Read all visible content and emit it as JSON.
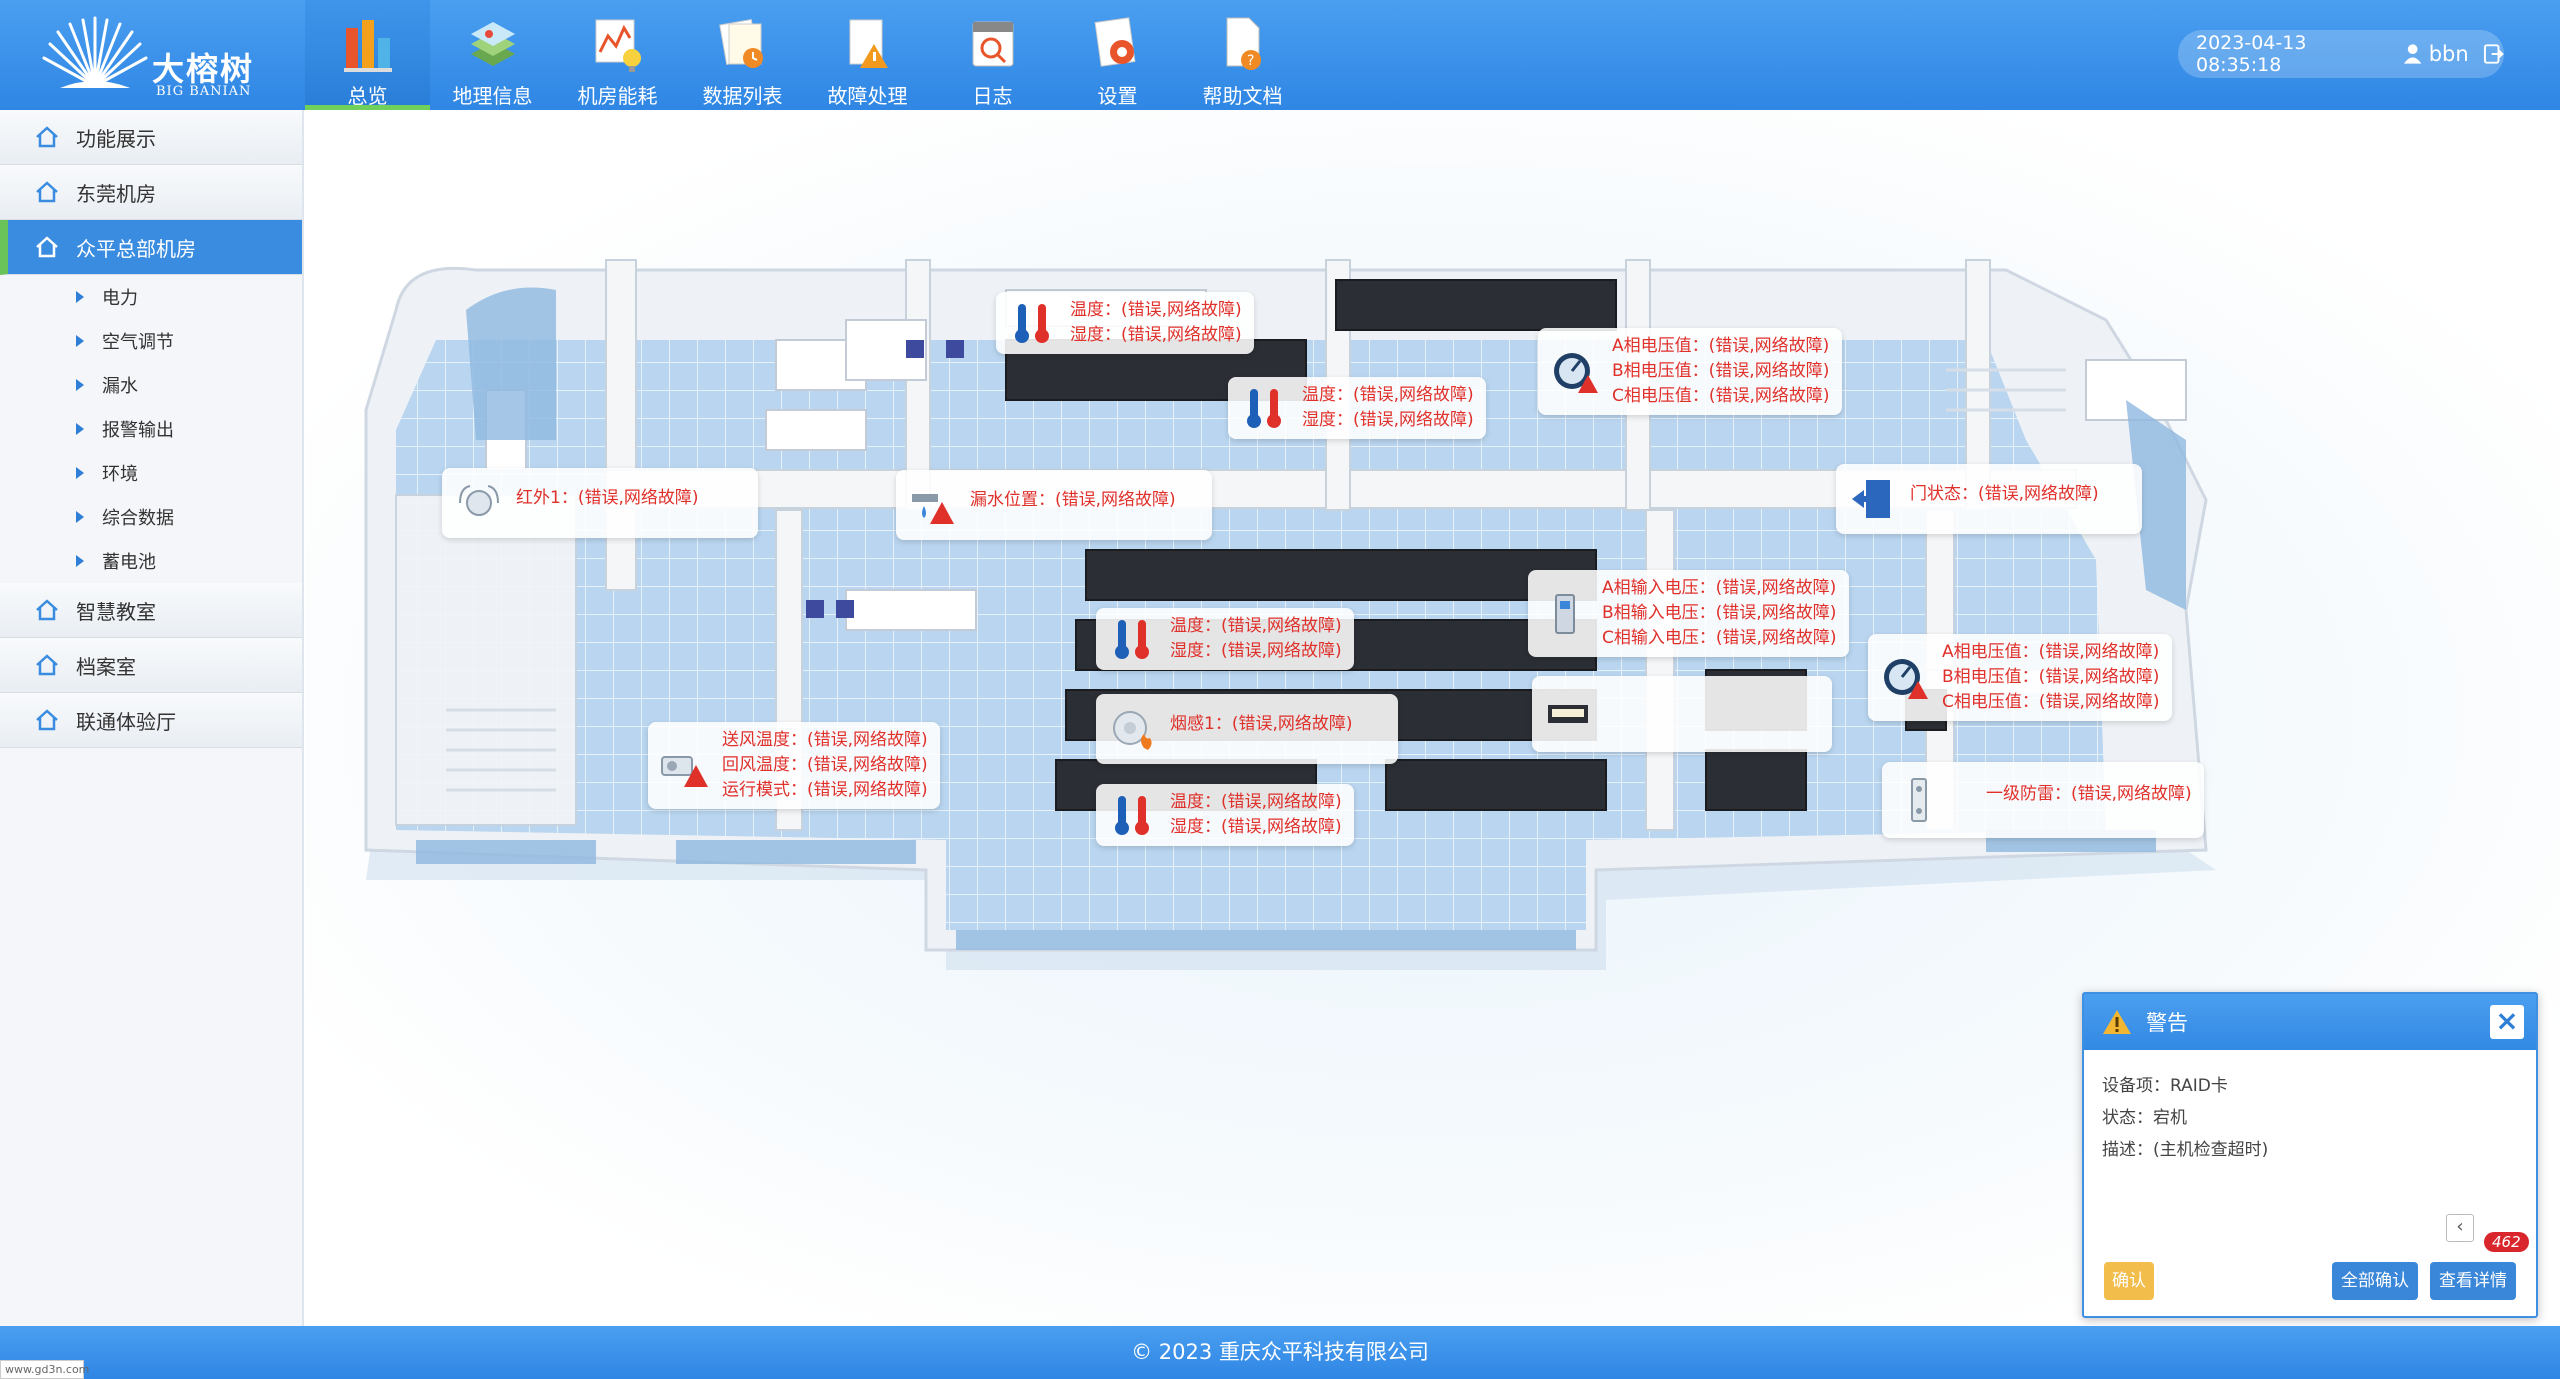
{
  "header": {
    "brand_cn": "大榕树",
    "brand_en": "BIG BANIAN",
    "nav": [
      {
        "label": "总览",
        "icon": "bar-chart-icon",
        "active": true
      },
      {
        "label": "地理信息",
        "icon": "map-layers-icon",
        "active": false
      },
      {
        "label": "机房能耗",
        "icon": "energy-chart-icon",
        "active": false
      },
      {
        "label": "数据列表",
        "icon": "data-list-icon",
        "active": false
      },
      {
        "label": "故障处理",
        "icon": "fault-warning-icon",
        "active": false
      },
      {
        "label": "日志",
        "icon": "log-calendar-icon",
        "active": false
      },
      {
        "label": "设置",
        "icon": "settings-gear-icon",
        "active": false
      },
      {
        "label": "帮助文档",
        "icon": "help-document-icon",
        "active": false
      }
    ],
    "datetime": "2023-04-13  08:35:18",
    "username": "bbn"
  },
  "sidebar": {
    "items": [
      {
        "label": "功能展示",
        "active": false
      },
      {
        "label": "东莞机房",
        "active": false
      },
      {
        "label": "众平总部机房",
        "active": true
      }
    ],
    "subitems": [
      "电力",
      "空气调节",
      "漏水",
      "报警输出",
      "环境",
      "综合数据",
      "蓄电池"
    ],
    "items_after": [
      {
        "label": "智慧教室"
      },
      {
        "label": "档案室"
      },
      {
        "label": "联通体验厅"
      }
    ]
  },
  "tags": {
    "temp1": {
      "l1": "温度：(错误,网络故障)",
      "l2": "湿度：(错误,网络故障)"
    },
    "temp2": {
      "l1": "温度：(错误,网络故障)",
      "l2": "湿度：(错误,网络故障)"
    },
    "volt1": {
      "l1": "A相电压值：(错误,网络故障)",
      "l2": "B相电压值：(错误,网络故障)",
      "l3": "C相电压值：(错误,网络故障)"
    },
    "infrared": {
      "l1": "红外1：(错误,网络故障)"
    },
    "leak": {
      "l1": "漏水位置：(错误,网络故障)"
    },
    "door": {
      "l1": "门状态：(错误,网络故障)"
    },
    "input_volt": {
      "l1": "A相输入电压：(错误,网络故障)",
      "l2": "B相输入电压：(错误,网络故障)",
      "l3": "C相输入电压：(错误,网络故障)"
    },
    "temp3": {
      "l1": "温度：(错误,网络故障)",
      "l2": "湿度：(错误,网络故障)"
    },
    "volt2": {
      "l1": "A相电压值：(错误,网络故障)",
      "l2": "B相电压值：(错误,网络故障)",
      "l3": "C相电压值：(错误,网络故障)"
    },
    "smoke": {
      "l1": "烟感1：(错误,网络故障)"
    },
    "aircon": {
      "l1": "送风温度：(错误,网络故障)",
      "l2": "回风温度：(错误,网络故障)",
      "l3": "运行模式：(错误,网络故障)"
    },
    "temp4": {
      "l1": "温度：(错误,网络故障)",
      "l2": "湿度：(错误,网络故障)"
    },
    "lightning": {
      "l1": "一级防雷：(错误,网络故障)"
    }
  },
  "alert": {
    "title": "警告",
    "device": "设备项：RAID卡",
    "status": "状态：宕机",
    "desc": "描述：(主机检查超时)",
    "collapse": "‹",
    "badge": "462",
    "confirm": "确认",
    "confirm_all": "全部确认",
    "detail": "查看详情"
  },
  "footer": {
    "text": "© 2023   重庆众平科技有限公司"
  },
  "watermark": "www.gd3n.com",
  "colors": {
    "header_blue": "#3a8fe8",
    "alarm_red": "#e0302a",
    "active_green": "#69c358",
    "confirm_yellow": "#f2bd4b"
  }
}
